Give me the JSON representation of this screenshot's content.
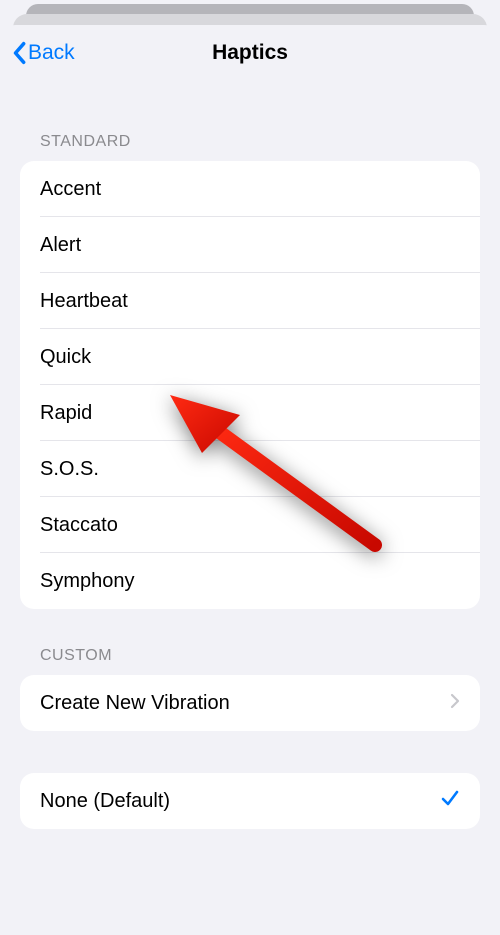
{
  "nav": {
    "back_label": "Back",
    "title": "Haptics"
  },
  "sections": {
    "standard": {
      "header": "STANDARD",
      "items": [
        {
          "label": "Accent"
        },
        {
          "label": "Alert"
        },
        {
          "label": "Heartbeat"
        },
        {
          "label": "Quick"
        },
        {
          "label": "Rapid"
        },
        {
          "label": "S.O.S."
        },
        {
          "label": "Staccato"
        },
        {
          "label": "Symphony"
        }
      ]
    },
    "custom": {
      "header": "CUSTOM",
      "create_label": "Create New Vibration"
    },
    "none": {
      "label": "None (Default)",
      "selected": true
    }
  },
  "annotation": {
    "arrow_color": "#e6130a",
    "target": "Quick"
  }
}
